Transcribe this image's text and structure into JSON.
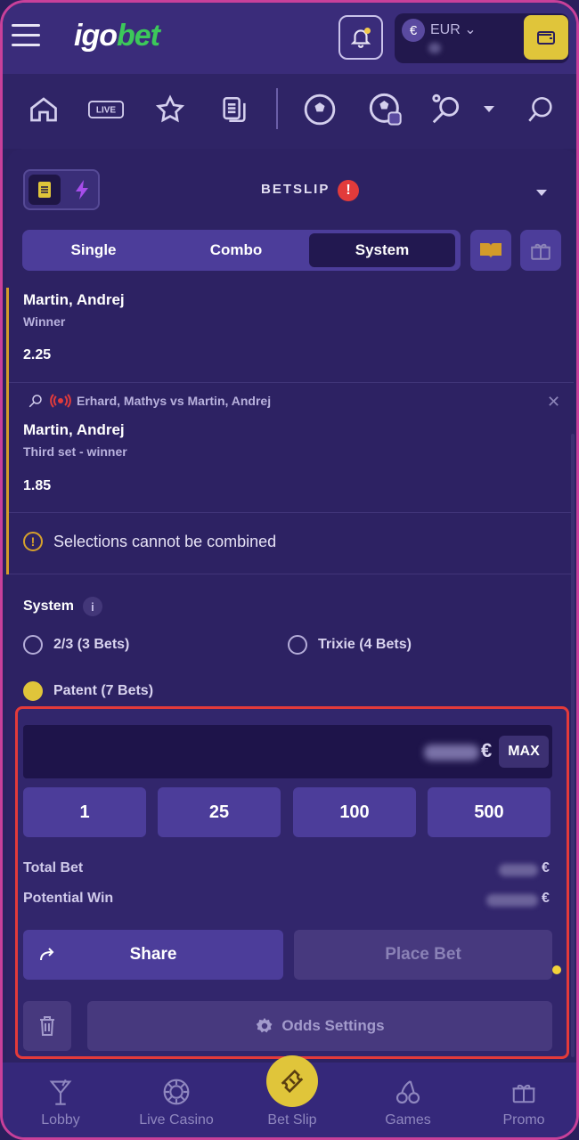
{
  "header": {
    "logo_igo": "igo",
    "logo_bet": "bet",
    "currency_symbol": "€",
    "currency_code": "EUR"
  },
  "betslip": {
    "title": "BETSLIP",
    "alert": "!",
    "tabs": [
      "Single",
      "Combo",
      "System"
    ],
    "active_tab": "System",
    "selections": [
      {
        "name": "Martin, Andrej",
        "market": "Winner",
        "odds": "2.25"
      },
      {
        "match": "Erhard, Mathys vs Martin, Andrej",
        "name": "Martin, Andrej",
        "market": "Third set - winner",
        "odds": "1.85"
      }
    ],
    "warning": "Selections cannot be combined",
    "system": {
      "label": "System",
      "info": "i",
      "options": [
        {
          "label": "2/3 (3 Bets)",
          "selected": false
        },
        {
          "label": "Trixie (4 Bets)",
          "selected": false
        },
        {
          "label": "Patent (7 Bets)",
          "selected": true
        }
      ]
    },
    "stake": {
      "currency": "€",
      "max_label": "MAX",
      "quick_amounts": [
        "1",
        "25",
        "100",
        "500"
      ],
      "total_bet_label": "Total Bet",
      "potential_win_label": "Potential Win",
      "share_label": "Share",
      "place_bet_label": "Place Bet",
      "odds_settings_label": "Odds Settings"
    }
  },
  "bottom_nav": [
    {
      "label": "Lobby",
      "icon": "cocktail-icon"
    },
    {
      "label": "Live Casino",
      "icon": "chip-icon"
    },
    {
      "label": "Bet Slip",
      "icon": "ticket-icon"
    },
    {
      "label": "Games",
      "icon": "cherries-icon"
    },
    {
      "label": "Promo",
      "icon": "gift-icon"
    }
  ],
  "colors": {
    "accent_yellow": "#e0c53a",
    "brand_green": "#3cc85a",
    "alert_red": "#e23b3b",
    "background": "#2c2160"
  }
}
